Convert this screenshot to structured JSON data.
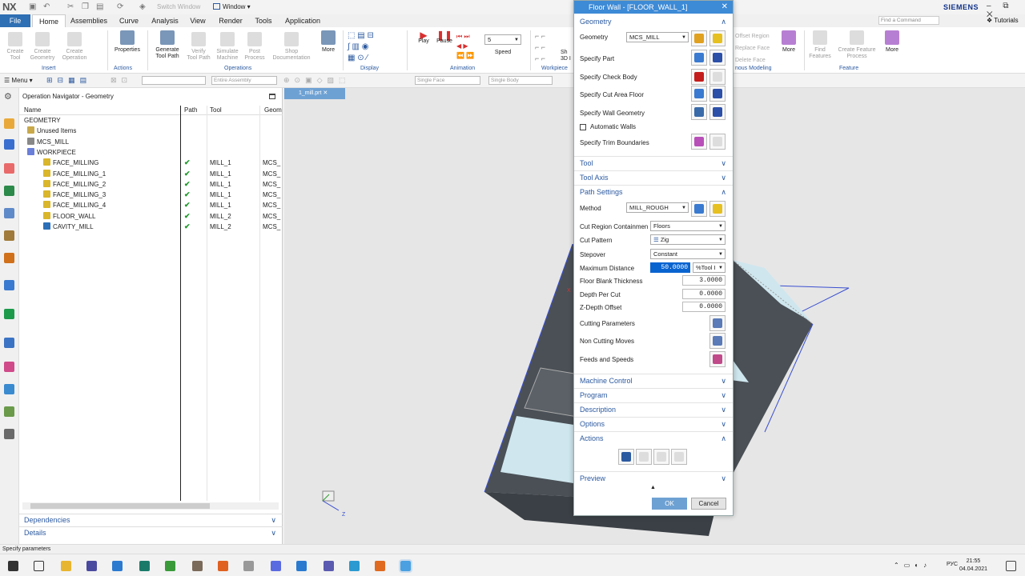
{
  "app": {
    "logo": "NX",
    "switch_window": "Switch Window",
    "window_menu": "Window",
    "brand": "SIEMENS",
    "find_command_placeholder": "Find a Command",
    "tutorials": "Tutorials",
    "window_controls": "– ⧉ ✕"
  },
  "tabs": [
    "File",
    "Home",
    "Assemblies",
    "Curve",
    "Analysis",
    "View",
    "Render",
    "Tools",
    "Application"
  ],
  "ribbon": {
    "buttons": [
      "Create Tool",
      "Create Geometry",
      "Create Operation",
      "Properties",
      "Generate Tool Path",
      "Verify Tool Path",
      "Simulate Machine",
      "Post Process",
      "Shop Documentation",
      "More",
      "Play",
      "Pause",
      "Speed",
      "More",
      "Find Features",
      "Create Feature Process",
      "More"
    ],
    "speed_value": "5",
    "groups": [
      "Insert",
      "Actions",
      "Operations",
      "Display",
      "Animation",
      "Workpiece",
      "nous Modeling",
      "Feature"
    ],
    "right_items": [
      "Offset Region",
      "Replace Face",
      "Delete Face"
    ],
    "partial": "Sh",
    "partial2": "3D I"
  },
  "toolbar2": {
    "menu": "Menu",
    "filter1": "",
    "filter2": "Entire Assembly",
    "filter3": "Single Face",
    "filter4": "Single Body"
  },
  "navigator": {
    "title": "Operation Navigator - Geometry",
    "columns": [
      "Name",
      "Path",
      "Tool",
      "Geom"
    ],
    "rows": [
      {
        "name": "GEOMETRY",
        "path": "",
        "tool": "",
        "geom": "",
        "level": 0,
        "icon": ""
      },
      {
        "name": "Unused Items",
        "path": "",
        "tool": "",
        "geom": "",
        "level": 1,
        "icon": "#c9a94a"
      },
      {
        "name": "MCS_MILL",
        "path": "",
        "tool": "",
        "geom": "",
        "level": 1,
        "icon": "#888"
      },
      {
        "name": "WORKPIECE",
        "path": "",
        "tool": "",
        "geom": "",
        "level": 2,
        "icon": "#6a7fd8"
      },
      {
        "name": "FACE_MILLING",
        "path": "✔",
        "tool": "MILL_1",
        "geom": "MCS_",
        "level": 3,
        "icon": "#d9b62b"
      },
      {
        "name": "FACE_MILLING_1",
        "path": "✔",
        "tool": "MILL_1",
        "geom": "MCS_",
        "level": 3,
        "icon": "#d9b62b"
      },
      {
        "name": "FACE_MILLING_2",
        "path": "✔",
        "tool": "MILL_1",
        "geom": "MCS_",
        "level": 3,
        "icon": "#d9b62b"
      },
      {
        "name": "FACE_MILLING_3",
        "path": "✔",
        "tool": "MILL_1",
        "geom": "MCS_",
        "level": 3,
        "icon": "#d9b62b"
      },
      {
        "name": "FACE_MILLING_4",
        "path": "✔",
        "tool": "MILL_1",
        "geom": "MCS_",
        "level": 3,
        "icon": "#d9b62b"
      },
      {
        "name": "FLOOR_WALL",
        "path": "✔",
        "tool": "MILL_2",
        "geom": "MCS_",
        "level": 3,
        "icon": "#d9b62b"
      },
      {
        "name": "CAVITY_MILL",
        "path": "✔",
        "tool": "MILL_2",
        "geom": "MCS_",
        "level": 3,
        "icon": "#2c6fb8"
      }
    ],
    "panels": [
      "Dependencies",
      "Details"
    ]
  },
  "viewport": {
    "tab": "1_mill.prt",
    "axis_x": "X",
    "axis_z": "Z"
  },
  "dialog": {
    "title": "Floor Wall - [FLOOR_WALL_1]",
    "geometry": {
      "header": "Geometry",
      "geometry_label": "Geometry",
      "geometry_value": "MCS_MILL",
      "specify_part": "Specify Part",
      "specify_check": "Specify Check Body",
      "specify_floor": "Specify Cut Area Floor",
      "specify_wall": "Specify Wall Geometry",
      "automatic_walls": "Automatic Walls",
      "trim_bounds": "Specify Trim Boundaries"
    },
    "tool": "Tool",
    "tool_axis": "Tool Axis",
    "path": {
      "header": "Path Settings",
      "method_label": "Method",
      "method_value": "MILL_ROUGH",
      "region_label": "Cut Region Containmen",
      "region_value": "Floors",
      "pattern_label": "Cut Pattern",
      "pattern_value": "Zig",
      "stepover_label": "Stepover",
      "stepover_value": "Constant",
      "maxdist_label": "Maximum Distance",
      "maxdist_value": "50.0000",
      "maxdist_unit": "%Tool I",
      "floor_blank_label": "Floor Blank Thickness",
      "floor_blank_value": "3.0000",
      "depth_label": "Depth Per Cut",
      "depth_value": "0.0000",
      "zdepth_label": "Z-Depth Offset",
      "zdepth_value": "0.0000",
      "cutting_params": "Cutting Parameters",
      "non_cutting": "Non Cutting Moves",
      "feeds": "Feeds and Speeds"
    },
    "machine_control": "Machine Control",
    "program": "Program",
    "description": "Description",
    "options": "Options",
    "actions": "Actions",
    "preview": "Preview",
    "ok": "OK",
    "cancel": "Cancel"
  },
  "status": "Specify parameters",
  "taskbar": {
    "lang": "РУС",
    "time": "21:55",
    "date": "04.04.2021"
  }
}
